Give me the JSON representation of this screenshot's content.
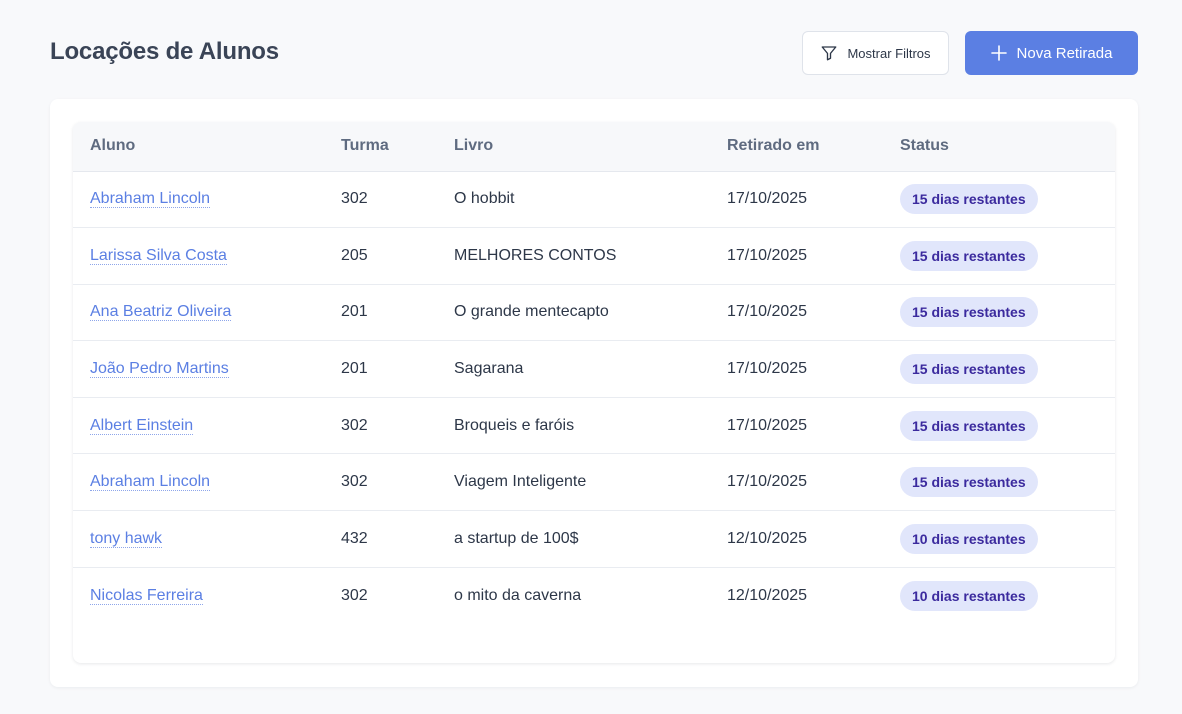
{
  "header": {
    "title": "Locações de Alunos",
    "filter_label": "Mostrar Filtros",
    "new_label": "Nova Retirada"
  },
  "colors": {
    "primary": "#5b7fe3",
    "badge_bg": "#e1e6fb",
    "badge_text": "#3b2a9e"
  },
  "icons": {
    "filter": "filter-icon",
    "add": "plus-icon"
  },
  "table": {
    "columns": [
      "Aluno",
      "Turma",
      "Livro",
      "Retirado em",
      "Status"
    ],
    "rows": [
      {
        "aluno": "Abraham Lincoln",
        "turma": "302",
        "livro": "O hobbit",
        "data": "17/10/2025",
        "status": "15 dias restantes"
      },
      {
        "aluno": "Larissa Silva Costa",
        "turma": "205",
        "livro": "MELHORES CONTOS",
        "data": "17/10/2025",
        "status": "15 dias restantes"
      },
      {
        "aluno": "Ana Beatriz Oliveira",
        "turma": "201",
        "livro": "O grande mentecapto",
        "data": "17/10/2025",
        "status": "15 dias restantes"
      },
      {
        "aluno": "João Pedro Martins",
        "turma": "201",
        "livro": "Sagarana",
        "data": "17/10/2025",
        "status": "15 dias restantes"
      },
      {
        "aluno": "Albert Einstein",
        "turma": "302",
        "livro": "Broqueis e faróis",
        "data": "17/10/2025",
        "status": "15 dias restantes"
      },
      {
        "aluno": "Abraham Lincoln",
        "turma": "302",
        "livro": "Viagem Inteligente",
        "data": "17/10/2025",
        "status": "15 dias restantes"
      },
      {
        "aluno": "tony hawk",
        "turma": "432",
        "livro": "a startup de 100$",
        "data": "12/10/2025",
        "status": "10 dias restantes"
      },
      {
        "aluno": "Nicolas Ferreira",
        "turma": "302",
        "livro": "o mito da caverna",
        "data": "12/10/2025",
        "status": "10 dias restantes"
      }
    ]
  }
}
